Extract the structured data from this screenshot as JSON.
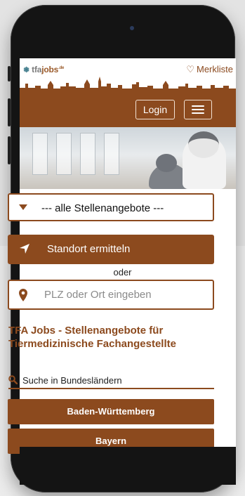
{
  "colors": {
    "brand_brown": "#8c4a1e",
    "teal": "#3d7a8a"
  },
  "header": {
    "logo_text": "tfa",
    "logo_brand": "jobs",
    "logo_tld": ".de",
    "merkliste": "Merkliste",
    "login": "Login"
  },
  "filter": {
    "select_value": "--- alle Stellenangebote ---",
    "locate_label": "Standort ermitteln",
    "oder": "oder",
    "plz_placeholder": "PLZ oder Ort eingeben"
  },
  "main": {
    "heading": "TFA Jobs - Stellenangebote für Tiermedizinische Fachangestellte",
    "search_states": "Suche in Bundesländern",
    "states": [
      "Baden-Württemberg",
      "Bayern"
    ]
  },
  "icons": {
    "paw": "paw-icon",
    "heart": "heart-icon",
    "menu": "hamburger-menu-icon",
    "caret": "caret-down-icon",
    "locate": "location-arrow-icon",
    "pin": "map-pin-icon",
    "search": "search-icon"
  }
}
